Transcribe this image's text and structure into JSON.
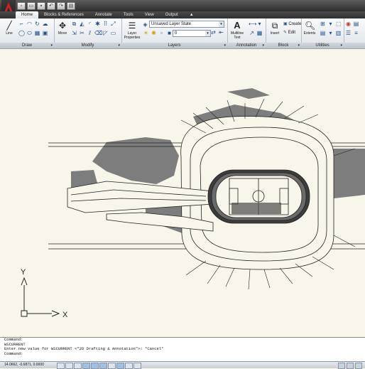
{
  "window": {
    "quick_access_icons": [
      "new-icon",
      "open-icon",
      "save-icon",
      "undo-icon",
      "redo-icon",
      "print-icon"
    ]
  },
  "ribbon": {
    "tabs": [
      "Home",
      "Blocks & References",
      "Annotate",
      "Tools",
      "View",
      "Output"
    ],
    "active_tab": "Home",
    "panels": {
      "draw": {
        "title": "Draw",
        "line_label": "Line"
      },
      "modify": {
        "title": "Modify",
        "move_label": "Move"
      },
      "layers": {
        "title": "Layers",
        "layer_properties_label": "Layer\nProperties",
        "layer_state_value": "Unsaved Layer State",
        "layer_value": "0"
      },
      "annotation": {
        "title": "Annotation",
        "multiline_text_label": "Multiline\nText"
      },
      "block": {
        "title": "Block",
        "insert_label": "Insert",
        "create_label": "Create",
        "edit_label": "Edit"
      },
      "utilities": {
        "title": "Utilities",
        "extents_label": "Extents"
      }
    }
  },
  "ucs": {
    "x_label": "X",
    "y_label": "Y"
  },
  "command_line": {
    "lines": [
      "Command:",
      "WSCURRENT",
      "Enter new value for WSCURRENT <\"2D Drafting & Annotation\">: *Cancel*",
      "Command:"
    ]
  },
  "status_bar": {
    "coordinates": "14.0662, -0.6871, 0.0000"
  }
}
